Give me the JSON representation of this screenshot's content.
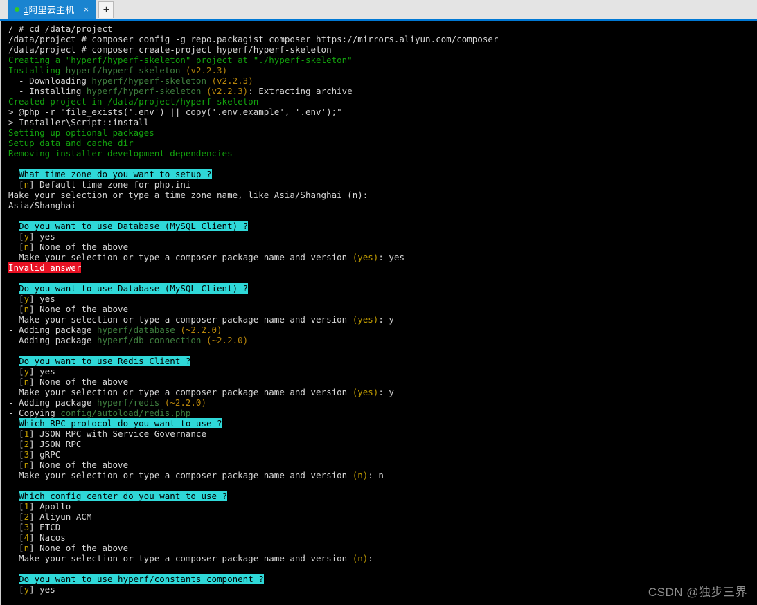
{
  "window": {
    "accent_color": "#0078d4",
    "tab_active_color": "#1a84d0",
    "terminal_bg": "#000000"
  },
  "tabbar": {
    "tab": {
      "index": "1",
      "title": "阿里云主机",
      "status_dot_color": "#34c924",
      "close_label": "×"
    },
    "new_tab_label": "+"
  },
  "watermark": {
    "text": "CSDN @独步三界"
  },
  "terminal": {
    "palette": {
      "default": "#d6d6d6",
      "info_green": "#13a10e",
      "package_green": "#3f7f3f",
      "option_yellow": "#b8860b",
      "highlight_bg": "#2fd8d8",
      "error_bg": "#e81123"
    },
    "lines": [
      {
        "segs": [
          {
            "t": "/ # cd /data/project",
            "c": "c-white"
          }
        ]
      },
      {
        "segs": [
          {
            "t": "/data/project # composer config -g repo.packagist composer https://mirrors.aliyun.com/composer",
            "c": "c-white"
          }
        ]
      },
      {
        "segs": [
          {
            "t": "/data/project # composer create-project hyperf/hyperf-skeleton",
            "c": "c-white"
          }
        ]
      },
      {
        "segs": [
          {
            "t": "Creating a \"hyperf/hyperf-skeleton\" project at \"./hyperf-skeleton\"",
            "c": "c-green"
          }
        ]
      },
      {
        "segs": [
          {
            "t": "Installing ",
            "c": "c-green"
          },
          {
            "t": "hyperf/hyperf-skeleton",
            "c": "c-pkg"
          },
          {
            "t": " ",
            "c": "c-green"
          },
          {
            "t": "(v2.2.3)",
            "c": "c-yellow"
          }
        ]
      },
      {
        "segs": [
          {
            "t": "  - Downloading ",
            "c": "c-white"
          },
          {
            "t": "hyperf/hyperf-skeleton",
            "c": "c-pkg"
          },
          {
            "t": " ",
            "c": "c-white"
          },
          {
            "t": "(v2.2.3)",
            "c": "c-yellow"
          }
        ]
      },
      {
        "segs": [
          {
            "t": "  - Installing ",
            "c": "c-white"
          },
          {
            "t": "hyperf/hyperf-skeleton",
            "c": "c-pkg"
          },
          {
            "t": " ",
            "c": "c-white"
          },
          {
            "t": "(v2.2.3)",
            "c": "c-yellow"
          },
          {
            "t": ": Extracting archive",
            "c": "c-white"
          }
        ]
      },
      {
        "segs": [
          {
            "t": "Created project in /data/project/hyperf-skeleton",
            "c": "c-green"
          }
        ]
      },
      {
        "segs": [
          {
            "t": "> @php -r \"file_exists('.env') || copy('.env.example', '.env');\"",
            "c": "c-white"
          }
        ]
      },
      {
        "segs": [
          {
            "t": "> Installer\\Script::install",
            "c": "c-white"
          }
        ]
      },
      {
        "segs": [
          {
            "t": "Setting up optional packages",
            "c": "c-green"
          }
        ]
      },
      {
        "segs": [
          {
            "t": "Setup data and cache dir",
            "c": "c-green"
          }
        ]
      },
      {
        "segs": [
          {
            "t": "Removing installer development dependencies",
            "c": "c-green"
          }
        ]
      },
      {
        "segs": []
      },
      {
        "segs": [
          {
            "t": "  ",
            "c": "c-white"
          },
          {
            "t": "What time zone do you want to setup ?",
            "c": "c-cyanbg"
          }
        ]
      },
      {
        "segs": [
          {
            "t": "  [",
            "c": "c-white"
          },
          {
            "t": "n",
            "c": "c-yellow2"
          },
          {
            "t": "] Default time zone for php.ini",
            "c": "c-white"
          }
        ]
      },
      {
        "segs": [
          {
            "t": "Make your selection or type a time zone name, like Asia/Shanghai (n): ",
            "c": "c-white"
          }
        ]
      },
      {
        "segs": [
          {
            "t": "Asia/Shanghai",
            "c": "c-white"
          }
        ]
      },
      {
        "segs": []
      },
      {
        "segs": [
          {
            "t": "  ",
            "c": "c-white"
          },
          {
            "t": "Do you want to use Database (MySQL Client) ?",
            "c": "c-cyanbg"
          }
        ]
      },
      {
        "segs": [
          {
            "t": "  [",
            "c": "c-white"
          },
          {
            "t": "y",
            "c": "c-yellow2"
          },
          {
            "t": "] yes",
            "c": "c-white"
          }
        ]
      },
      {
        "segs": [
          {
            "t": "  [",
            "c": "c-white"
          },
          {
            "t": "n",
            "c": "c-yellow2"
          },
          {
            "t": "] None of the above",
            "c": "c-white"
          }
        ]
      },
      {
        "segs": [
          {
            "t": "  Make your selection or type a composer package name and version ",
            "c": "c-white"
          },
          {
            "t": "(yes)",
            "c": "c-yellow2"
          },
          {
            "t": ": yes",
            "c": "c-white"
          }
        ]
      },
      {
        "segs": [
          {
            "t": "Invalid answer",
            "c": "c-redbg"
          }
        ]
      },
      {
        "segs": []
      },
      {
        "segs": [
          {
            "t": "  ",
            "c": "c-white"
          },
          {
            "t": "Do you want to use Database (MySQL Client) ?",
            "c": "c-cyanbg"
          }
        ]
      },
      {
        "segs": [
          {
            "t": "  [",
            "c": "c-white"
          },
          {
            "t": "y",
            "c": "c-yellow2"
          },
          {
            "t": "] yes",
            "c": "c-white"
          }
        ]
      },
      {
        "segs": [
          {
            "t": "  [",
            "c": "c-white"
          },
          {
            "t": "n",
            "c": "c-yellow2"
          },
          {
            "t": "] None of the above",
            "c": "c-white"
          }
        ]
      },
      {
        "segs": [
          {
            "t": "  Make your selection or type a composer package name and version ",
            "c": "c-white"
          },
          {
            "t": "(yes)",
            "c": "c-yellow2"
          },
          {
            "t": ": y",
            "c": "c-white"
          }
        ]
      },
      {
        "segs": [
          {
            "t": "- Adding package ",
            "c": "c-white"
          },
          {
            "t": "hyperf/database",
            "c": "c-pkg"
          },
          {
            "t": " ",
            "c": "c-white"
          },
          {
            "t": "(~2.2.0)",
            "c": "c-yellow"
          }
        ]
      },
      {
        "segs": [
          {
            "t": "- Adding package ",
            "c": "c-white"
          },
          {
            "t": "hyperf/db-connection",
            "c": "c-pkg"
          },
          {
            "t": " ",
            "c": "c-white"
          },
          {
            "t": "(~2.2.0)",
            "c": "c-yellow"
          }
        ]
      },
      {
        "segs": []
      },
      {
        "segs": [
          {
            "t": "  ",
            "c": "c-white"
          },
          {
            "t": "Do you want to use Redis Client ?",
            "c": "c-cyanbg"
          }
        ]
      },
      {
        "segs": [
          {
            "t": "  [",
            "c": "c-white"
          },
          {
            "t": "y",
            "c": "c-yellow2"
          },
          {
            "t": "] yes",
            "c": "c-white"
          }
        ]
      },
      {
        "segs": [
          {
            "t": "  [",
            "c": "c-white"
          },
          {
            "t": "n",
            "c": "c-yellow2"
          },
          {
            "t": "] None of the above",
            "c": "c-white"
          }
        ]
      },
      {
        "segs": [
          {
            "t": "  Make your selection or type a composer package name and version ",
            "c": "c-white"
          },
          {
            "t": "(yes)",
            "c": "c-yellow2"
          },
          {
            "t": ": y",
            "c": "c-white"
          }
        ]
      },
      {
        "segs": [
          {
            "t": "- Adding package ",
            "c": "c-white"
          },
          {
            "t": "hyperf/redis",
            "c": "c-pkg"
          },
          {
            "t": " ",
            "c": "c-white"
          },
          {
            "t": "(~2.2.0)",
            "c": "c-yellow"
          }
        ]
      },
      {
        "segs": [
          {
            "t": "- Copying ",
            "c": "c-white"
          },
          {
            "t": "config/autoload/redis.php",
            "c": "c-pkg"
          }
        ]
      },
      {
        "segs": [
          {
            "t": "  ",
            "c": "c-white"
          },
          {
            "t": "Which RPC protocol do you want to use ?",
            "c": "c-cyanbg"
          }
        ]
      },
      {
        "segs": [
          {
            "t": "  [",
            "c": "c-white"
          },
          {
            "t": "1",
            "c": "c-yellow2"
          },
          {
            "t": "] JSON RPC with Service Governance",
            "c": "c-white"
          }
        ]
      },
      {
        "segs": [
          {
            "t": "  [",
            "c": "c-white"
          },
          {
            "t": "2",
            "c": "c-yellow2"
          },
          {
            "t": "] JSON RPC",
            "c": "c-white"
          }
        ]
      },
      {
        "segs": [
          {
            "t": "  [",
            "c": "c-white"
          },
          {
            "t": "3",
            "c": "c-yellow2"
          },
          {
            "t": "] gRPC",
            "c": "c-white"
          }
        ]
      },
      {
        "segs": [
          {
            "t": "  [",
            "c": "c-white"
          },
          {
            "t": "n",
            "c": "c-yellow2"
          },
          {
            "t": "] None of the above",
            "c": "c-white"
          }
        ]
      },
      {
        "segs": [
          {
            "t": "  Make your selection or type a composer package name and version ",
            "c": "c-white"
          },
          {
            "t": "(n)",
            "c": "c-yellow2"
          },
          {
            "t": ": n",
            "c": "c-white"
          }
        ]
      },
      {
        "segs": []
      },
      {
        "segs": [
          {
            "t": "  ",
            "c": "c-white"
          },
          {
            "t": "Which config center do you want to use ?",
            "c": "c-cyanbg"
          }
        ]
      },
      {
        "segs": [
          {
            "t": "  [",
            "c": "c-white"
          },
          {
            "t": "1",
            "c": "c-yellow2"
          },
          {
            "t": "] Apollo",
            "c": "c-white"
          }
        ]
      },
      {
        "segs": [
          {
            "t": "  [",
            "c": "c-white"
          },
          {
            "t": "2",
            "c": "c-yellow2"
          },
          {
            "t": "] Aliyun ACM",
            "c": "c-white"
          }
        ]
      },
      {
        "segs": [
          {
            "t": "  [",
            "c": "c-white"
          },
          {
            "t": "3",
            "c": "c-yellow2"
          },
          {
            "t": "] ETCD",
            "c": "c-white"
          }
        ]
      },
      {
        "segs": [
          {
            "t": "  [",
            "c": "c-white"
          },
          {
            "t": "4",
            "c": "c-yellow2"
          },
          {
            "t": "] Nacos",
            "c": "c-white"
          }
        ]
      },
      {
        "segs": [
          {
            "t": "  [",
            "c": "c-white"
          },
          {
            "t": "n",
            "c": "c-yellow2"
          },
          {
            "t": "] None of the above",
            "c": "c-white"
          }
        ]
      },
      {
        "segs": [
          {
            "t": "  Make your selection or type a composer package name and version ",
            "c": "c-white"
          },
          {
            "t": "(n)",
            "c": "c-yellow2"
          },
          {
            "t": ":",
            "c": "c-white"
          }
        ]
      },
      {
        "segs": []
      },
      {
        "segs": [
          {
            "t": "  ",
            "c": "c-white"
          },
          {
            "t": "Do you want to use hyperf/constants component ?",
            "c": "c-cyanbg"
          }
        ]
      },
      {
        "segs": [
          {
            "t": "  [",
            "c": "c-white"
          },
          {
            "t": "y",
            "c": "c-yellow2"
          },
          {
            "t": "] yes",
            "c": "c-white"
          }
        ]
      }
    ]
  }
}
